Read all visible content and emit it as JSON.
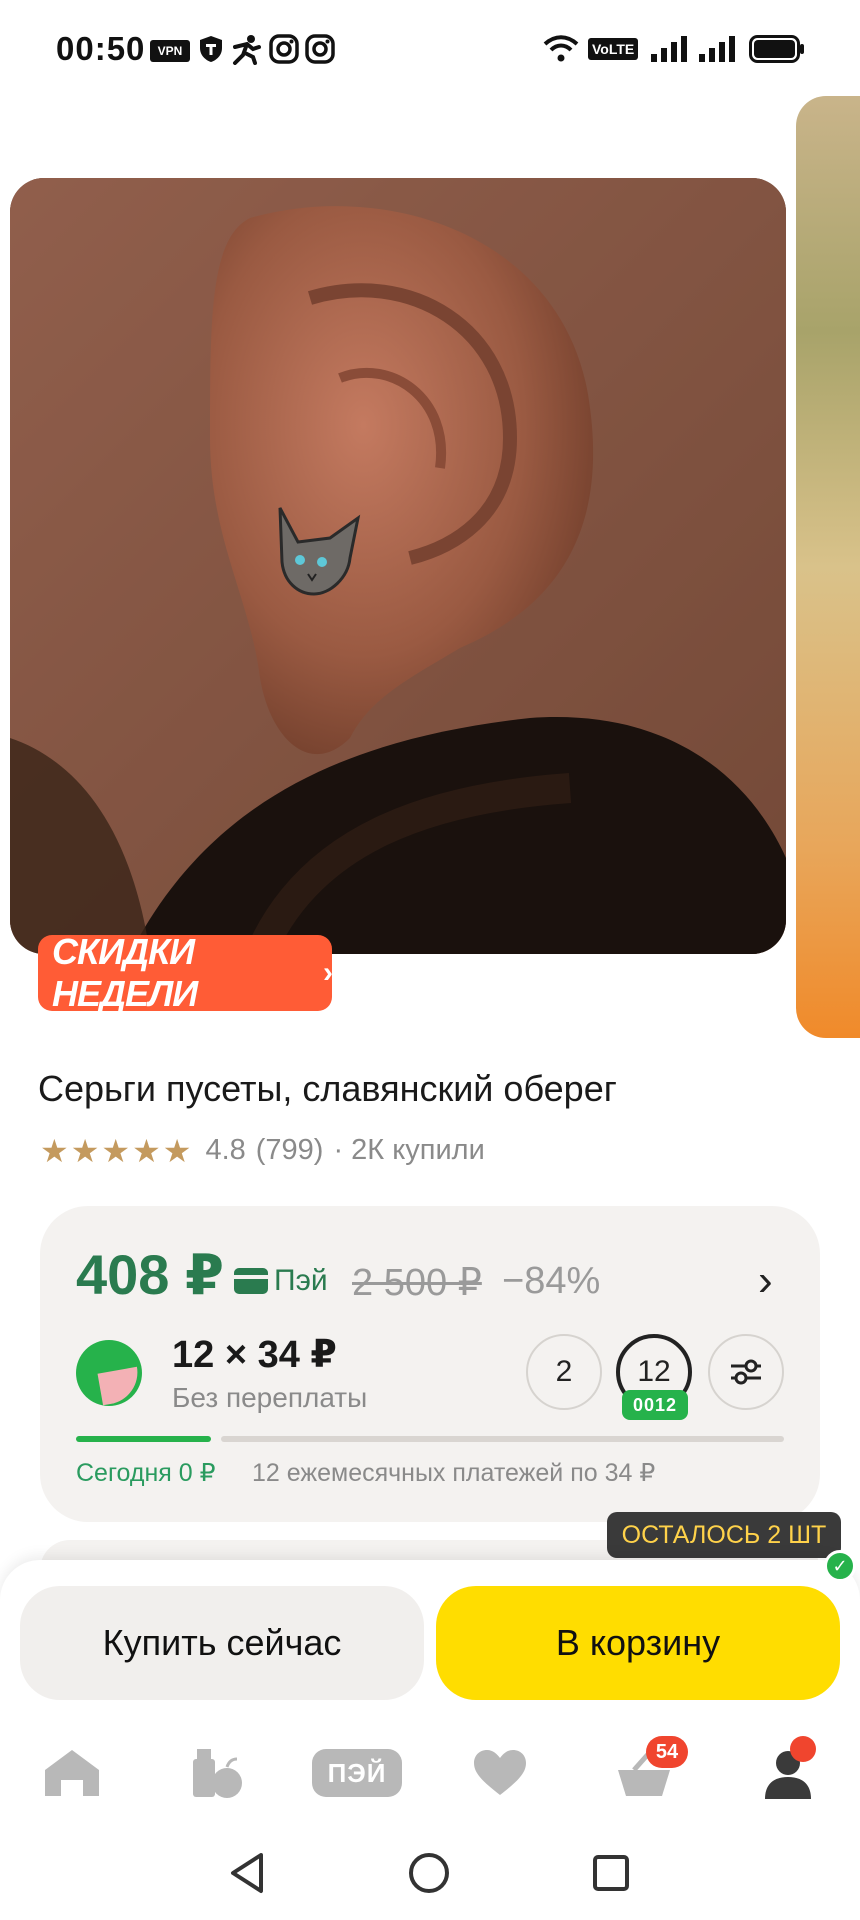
{
  "status_bar": {
    "time": "00:50",
    "vpn_label": "VPN",
    "volte_label": "VoLTE",
    "icons": [
      "vpn-icon",
      "shield-icon",
      "app-icon",
      "instagram-icon",
      "instagram-icon",
      "wifi-icon",
      "volte-icon",
      "signal-icon",
      "signal-icon",
      "battery-icon"
    ]
  },
  "gallery": {
    "promo_badge": "СКИДКИ НЕДЕЛИ",
    "promo_chevron": "›"
  },
  "product": {
    "title": "Серьги пусеты, славянский оберег",
    "rating_value": "4.8",
    "reviews_count": "(799)",
    "bought": "· 2К купили",
    "stars": 5
  },
  "price_card": {
    "price": "408 ₽",
    "pay_label": "Пэй",
    "old_price": "2 500 ₽",
    "discount": "−84%",
    "installment_main": "12 × 34 ₽",
    "installment_sub": "Без переплаты",
    "terms": [
      "2",
      "12"
    ],
    "selected_term": "12",
    "selected_term_badge": "0012",
    "progress_fraction": 0.19,
    "today_label": "Сегодня 0 ₽",
    "monthly_label": "12 ежемесячных платежей по 34 ₽"
  },
  "stock_badge": "ОСТАЛОСЬ 2 ШТ",
  "actions": {
    "buy_now": "Купить сейчас",
    "to_cart": "В корзину"
  },
  "tab_bar": {
    "pay_label": "ПЭЙ",
    "cart_count": "54"
  },
  "colors": {
    "accent_green": "#2a7b4f",
    "cart_yellow": "#ffdd00",
    "promo_orange": "#ff5c36",
    "badge_red": "#f0452e"
  }
}
